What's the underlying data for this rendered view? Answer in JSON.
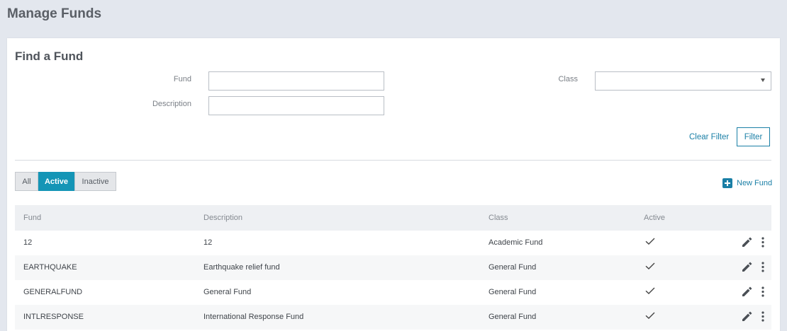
{
  "page": {
    "title": "Manage Funds"
  },
  "search": {
    "title": "Find a Fund",
    "fund_label": "Fund",
    "fund_value": "",
    "description_label": "Description",
    "description_value": "",
    "class_label": "Class",
    "class_value": "",
    "clear_label": "Clear Filter",
    "filter_label": "Filter"
  },
  "status_tabs": [
    {
      "label": "All",
      "active": false
    },
    {
      "label": "Active",
      "active": true
    },
    {
      "label": "Inactive",
      "active": false
    }
  ],
  "new_fund_label": "New Fund",
  "table": {
    "headers": [
      "Fund",
      "Description",
      "Class",
      "Active"
    ],
    "rows": [
      {
        "fund": "12",
        "description": "12",
        "class": "Academic Fund",
        "active": true
      },
      {
        "fund": "EARTHQUAKE",
        "description": "Earthquake relief fund",
        "class": "General Fund",
        "active": true
      },
      {
        "fund": "GENERALFUND",
        "description": "General Fund",
        "class": "General Fund",
        "active": true
      },
      {
        "fund": "INTLRESPONSE",
        "description": "International Response Fund",
        "class": "General Fund",
        "active": true
      }
    ]
  },
  "icons": {
    "edit": "pencil-icon",
    "more": "kebab-menu-icon",
    "active": "checkmark-icon",
    "dropdown": "chevron-down-icon",
    "add": "plus-icon"
  },
  "colors": {
    "accent": "#1495b6",
    "link": "#1a7fa6",
    "background": "#e3e7ee"
  }
}
